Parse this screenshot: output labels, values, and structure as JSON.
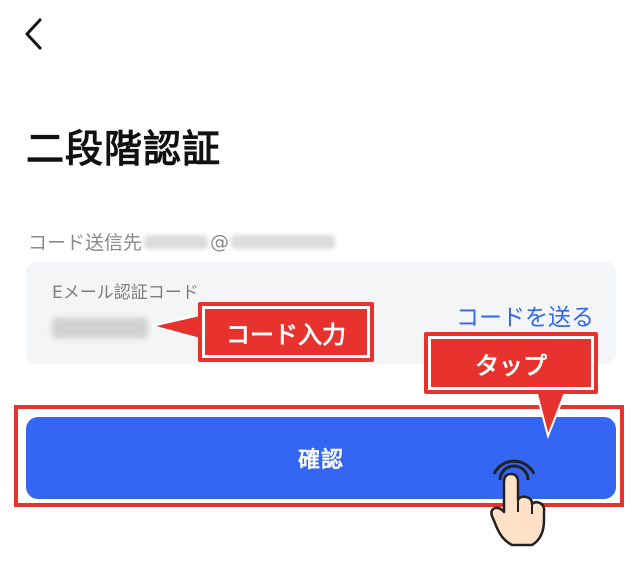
{
  "nav": {
    "back_icon": "chevron-left-icon"
  },
  "page": {
    "title": "二段階認証"
  },
  "destination": {
    "label": "コード送信先",
    "at_sign": "@"
  },
  "code_field": {
    "label": "Eメール認証コード",
    "send_code_link": "コードを送る"
  },
  "confirm": {
    "label": "確認"
  },
  "annotations": {
    "code_input": "コード入力",
    "tap": "タップ",
    "color": "#e8322d",
    "pointer_icon": "pointing-hand-icon"
  },
  "colors": {
    "primary_button": "#3566f3",
    "link": "#3168f0",
    "field_bg": "#f4f5f7",
    "annotation_red": "#e8322d"
  }
}
